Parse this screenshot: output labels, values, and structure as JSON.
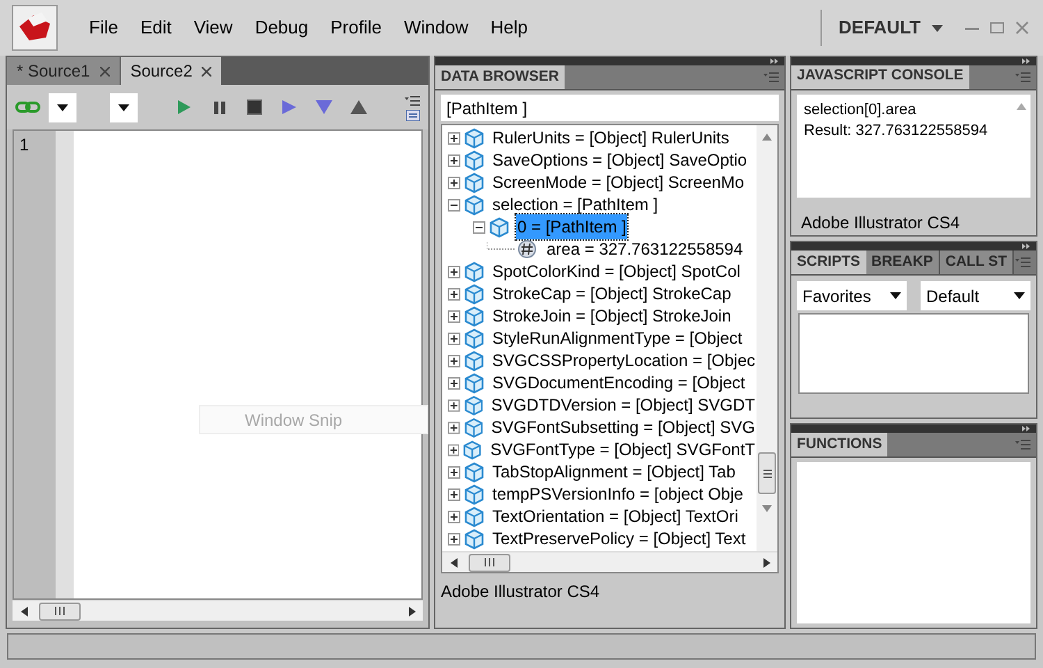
{
  "menu": [
    "File",
    "Edit",
    "View",
    "Debug",
    "Profile",
    "Window",
    "Help"
  ],
  "workspace": "DEFAULT",
  "editor": {
    "tabs": [
      {
        "label": "* Source1",
        "selected": false
      },
      {
        "label": "Source2",
        "selected": true
      }
    ],
    "line_numbers": [
      "1"
    ],
    "overlay_hint": "Window Snip"
  },
  "data_browser": {
    "title": "DATA BROWSER",
    "path": "[PathItem ]",
    "footer": "Adobe Illustrator CS4",
    "tree": [
      {
        "label": "RulerUnits = [Object] RulerUnits",
        "expanded": false,
        "selected": false
      },
      {
        "label": "SaveOptions = [Object] SaveOptio",
        "expanded": false,
        "selected": false
      },
      {
        "label": "ScreenMode = [Object] ScreenMo",
        "expanded": false,
        "selected": false
      },
      {
        "label": "selection = [PathItem ]",
        "expanded": true,
        "selected": false,
        "children": [
          {
            "label": "0 = [PathItem ]",
            "expanded": true,
            "selected": true,
            "children": [
              {
                "label": "area = 327.763122558594",
                "kind": "number",
                "selected": false
              }
            ]
          }
        ]
      },
      {
        "label": "SpotColorKind = [Object] SpotCol",
        "expanded": false,
        "selected": false
      },
      {
        "label": "StrokeCap = [Object] StrokeCap",
        "expanded": false,
        "selected": false
      },
      {
        "label": "StrokeJoin = [Object] StrokeJoin",
        "expanded": false,
        "selected": false
      },
      {
        "label": "StyleRunAlignmentType = [Object",
        "expanded": false,
        "selected": false
      },
      {
        "label": "SVGCSSPropertyLocation = [Objec",
        "expanded": false,
        "selected": false
      },
      {
        "label": "SVGDocumentEncoding = [Object",
        "expanded": false,
        "selected": false
      },
      {
        "label": "SVGDTDVersion = [Object] SVGDT",
        "expanded": false,
        "selected": false
      },
      {
        "label": "SVGFontSubsetting = [Object] SVG",
        "expanded": false,
        "selected": false
      },
      {
        "label": "SVGFontType = [Object] SVGFontT",
        "expanded": false,
        "selected": false
      },
      {
        "label": "TabStopAlignment = [Object] Tab",
        "expanded": false,
        "selected": false
      },
      {
        "label": "tempPSVersionInfo = [object Obje",
        "expanded": false,
        "selected": false
      },
      {
        "label": "TextOrientation = [Object] TextOri",
        "expanded": false,
        "selected": false
      },
      {
        "label": "TextPreservePolicy = [Object] Text",
        "expanded": false,
        "selected": false
      }
    ]
  },
  "console": {
    "title": "JAVASCRIPT CONSOLE",
    "lines": [
      "selection[0].area",
      "Result: 327.763122558594"
    ],
    "footer": "Adobe Illustrator CS4"
  },
  "scripts": {
    "tabs": [
      {
        "label": "SCRIPTS",
        "selected": true
      },
      {
        "label": "BREAKP",
        "selected": false
      },
      {
        "label": "CALL ST",
        "selected": false
      }
    ],
    "dropdowns": [
      "Favorites",
      "Default"
    ]
  },
  "functions": {
    "title": "FUNCTIONS"
  }
}
